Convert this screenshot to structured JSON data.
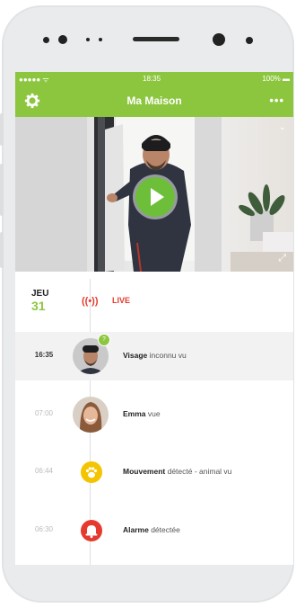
{
  "statusbar": {
    "signal": "●●●●● ᯤ",
    "time": "18:35",
    "battery": "100% ▬"
  },
  "header": {
    "title": "Ma Maison",
    "more": "•••"
  },
  "timeline": {
    "day_name": "JEU",
    "day_num": "31",
    "live_label": "LIVE",
    "events": [
      {
        "time": "16:35",
        "bold": "Visage",
        "rest": " inconnu vu",
        "badge": "?"
      },
      {
        "time": "07:00",
        "bold": "Emma",
        "rest": " vue"
      },
      {
        "time": "06:44",
        "bold": "Mouvement",
        "rest": " détecté - animal vu",
        "icon": "paw-icon"
      },
      {
        "time": "06:30",
        "bold": "Alarme",
        "rest": " détectée",
        "icon": "alarm-bell-icon"
      }
    ]
  },
  "colors": {
    "brand": "#8cc63f",
    "live": "#e63b2e",
    "motion": "#f4c400",
    "alarm": "#e53a2f"
  }
}
